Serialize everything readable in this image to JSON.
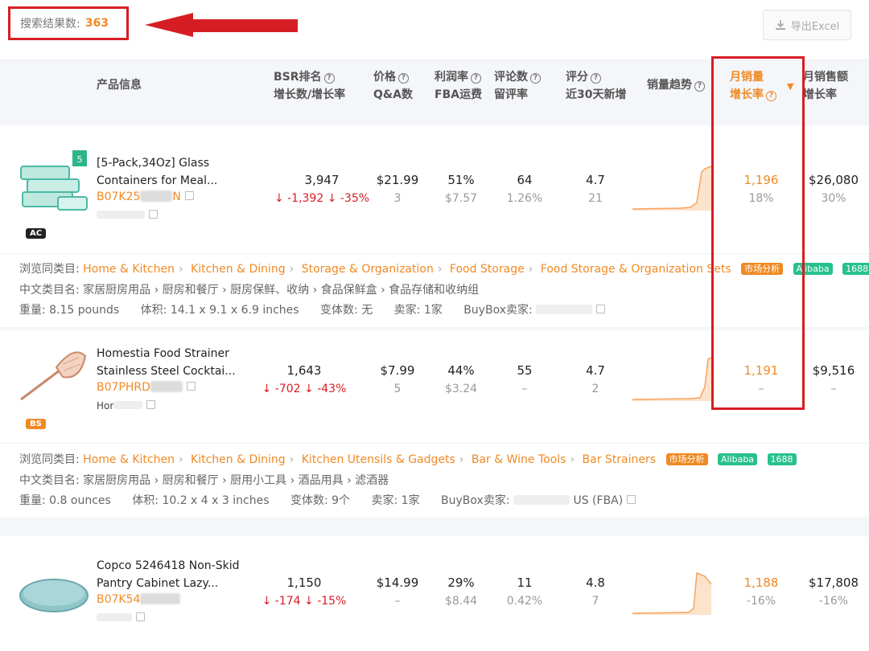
{
  "search": {
    "label": "搜索结果数:",
    "count": "363"
  },
  "export_label": "导出Excel",
  "headers": {
    "product": "产品信息",
    "bsr": "BSR排名",
    "bsr_sub": "增长数/增长率",
    "price": "价格",
    "price_sub": "Q&A数",
    "margin": "利润率",
    "margin_sub": "FBA运费",
    "reviews": "评论数",
    "reviews_sub": "留评率",
    "rating": "评分",
    "rating_sub": "近30天新增",
    "trend": "销量趋势",
    "monthly_sales": "月销量",
    "monthly_sales_sub": "增长率",
    "monthly_revenue": "月销售额",
    "monthly_revenue_sub": "增长率"
  },
  "meta_labels": {
    "browse": "浏览同类目:",
    "cn_category": "中文类目名:",
    "weight": "重量:",
    "volume": "体积:",
    "variants": "变体数:",
    "sellers": "卖家:",
    "buybox": "BuyBox卖家:",
    "market_tag": "市场分析",
    "alibaba_tag": "Alibaba",
    "tag_1688": "1688"
  },
  "products": [
    {
      "title_line1": "[5-Pack,34Oz] Glass",
      "title_line2": "Containers for Meal...",
      "asin_prefix": "B07K25",
      "asin_suffix": "N",
      "badge": "AC",
      "bsr": "3,947",
      "bsr_change": "↓ -1,392",
      "bsr_rate": "↓ -35%",
      "price": "$21.99",
      "qa": "3",
      "margin": "51%",
      "fba": "$7.57",
      "reviews": "64",
      "review_rate": "1.26%",
      "rating": "4.7",
      "rating_new": "21",
      "sales": "1,196",
      "sales_growth": "18%",
      "revenue": "$26,080",
      "revenue_growth": "30%",
      "categories": [
        "Home & Kitchen",
        "Kitchen & Dining",
        "Storage & Organization",
        "Food Storage",
        "Food Storage & Organization Sets"
      ],
      "cn_category": "家居厨房用品 › 厨房和餐厅 › 厨房保鲜、收纳 › 食品保鲜盒 › 食品存储和收纳组",
      "weight": "8.15 pounds",
      "volume": "14.1 x 9.1 x 6.9 inches",
      "variants": "无",
      "sellers": "1家",
      "buybox": ""
    },
    {
      "title_line1": "Homestia Food Strainer",
      "title_line2": "Stainless Steel Cocktai...",
      "asin_prefix": "B07PHRD",
      "asin_suffix": "",
      "brand": "Hor",
      "badge": "BS",
      "bsr": "1,643",
      "bsr_change": "↓ -702",
      "bsr_rate": "↓ -43%",
      "price": "$7.99",
      "qa": "5",
      "margin": "44%",
      "fba": "$3.24",
      "reviews": "55",
      "review_rate": "–",
      "rating": "4.7",
      "rating_new": "2",
      "sales": "1,191",
      "sales_growth": "–",
      "revenue": "$9,516",
      "revenue_growth": "–",
      "categories": [
        "Home & Kitchen",
        "Kitchen & Dining",
        "Kitchen Utensils & Gadgets",
        "Bar & Wine Tools",
        "Bar Strainers"
      ],
      "cn_category": "家居厨房用品 › 厨房和餐厅 › 厨用小工具 › 酒品用具 › 滤酒器",
      "weight": "0.8 ounces",
      "volume": "10.2 x 4 x 3 inches",
      "variants": "9个",
      "sellers": "1家",
      "buybox": "US (FBA)"
    },
    {
      "title_line1": "Copco 5246418 Non-Skid",
      "title_line2": "Pantry Cabinet Lazy...",
      "asin_prefix": "B07K54",
      "asin_suffix": "",
      "bsr": "1,150",
      "bsr_change": "↓ -174",
      "bsr_rate": "↓ -15%",
      "price": "$14.99",
      "qa": "–",
      "margin": "29%",
      "fba": "$8.44",
      "reviews": "11",
      "review_rate": "0.42%",
      "rating": "4.8",
      "rating_new": "7",
      "sales": "1,188",
      "sales_growth": "-16%",
      "revenue": "$17,808",
      "revenue_growth": "-16%"
    }
  ]
}
